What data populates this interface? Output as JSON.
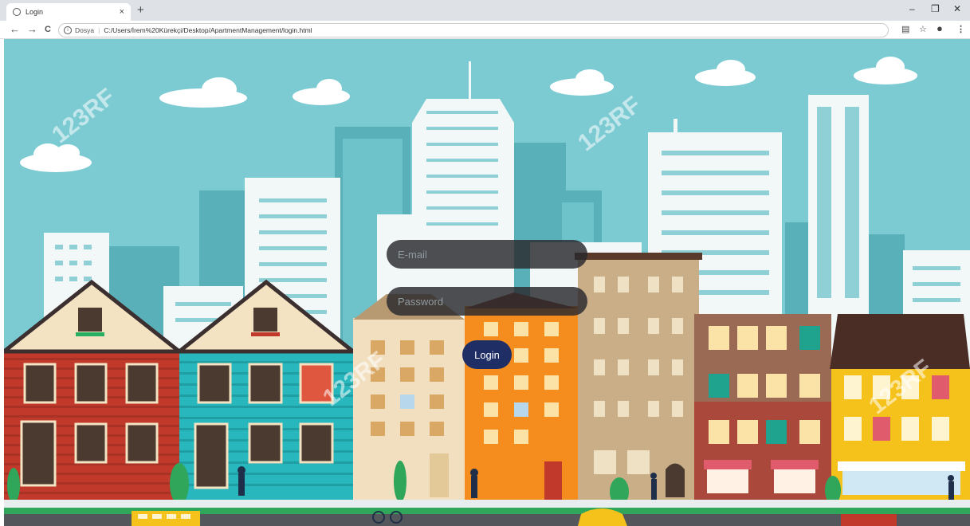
{
  "browser": {
    "tab_title": "Login",
    "tab_close": "×",
    "new_tab": "+",
    "back": "←",
    "forward": "→",
    "reload": "C",
    "scheme_label": "Dosya",
    "url": "C:/Users/İrem%20Kürekçi/Desktop/ApartmentManagement/login.html",
    "minimize": "–",
    "restore": "❐",
    "close": "✕",
    "translate_icon": "translate-icon",
    "star_icon": "star-icon",
    "account_icon": "account-icon",
    "menu_icon": "menu-icon"
  },
  "login": {
    "email_placeholder": "E-mail",
    "password_placeholder": "Password",
    "button_label": "Login"
  },
  "watermark": "123RF",
  "colors": {
    "sky": "#7ccbd3",
    "field_bg": "#28282d",
    "button_bg": "#1f2f66",
    "road": "#53565a",
    "grass": "#2fa65a"
  }
}
